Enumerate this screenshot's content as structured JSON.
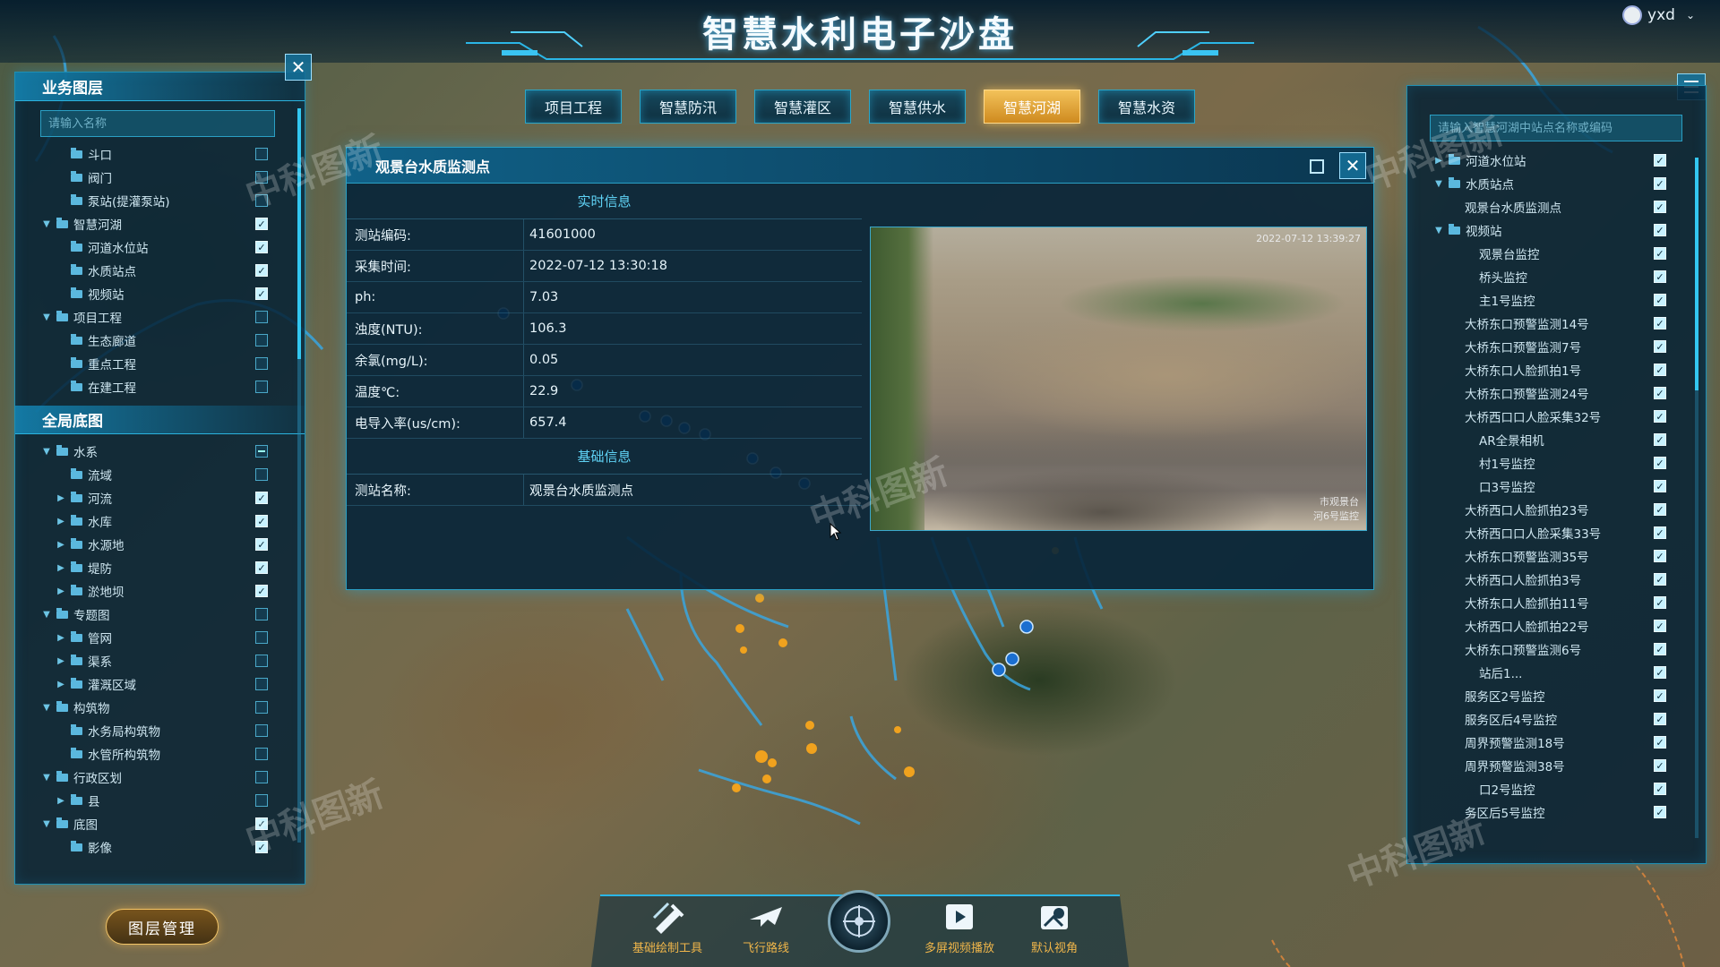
{
  "header": {
    "title": "智慧水利电子沙盘",
    "user": "yxd"
  },
  "tabs": [
    {
      "label": "项目工程",
      "active": false
    },
    {
      "label": "智慧防汛",
      "active": false
    },
    {
      "label": "智慧灌区",
      "active": false
    },
    {
      "label": "智慧供水",
      "active": false
    },
    {
      "label": "智慧河湖",
      "active": true
    },
    {
      "label": "智慧水资",
      "active": false
    }
  ],
  "left_panel": {
    "section1_title": "业务图层",
    "search_placeholder": "请输入名称",
    "layers1": [
      {
        "label": "斗口",
        "indent": 2,
        "arrow": "",
        "check": "off"
      },
      {
        "label": "阀门",
        "indent": 2,
        "arrow": "",
        "check": "off"
      },
      {
        "label": "泵站(提灌泵站)",
        "indent": 2,
        "arrow": "",
        "check": "off"
      },
      {
        "label": "智慧河湖",
        "indent": 1,
        "arrow": "▼",
        "check": "on"
      },
      {
        "label": "河道水位站",
        "indent": 2,
        "arrow": "",
        "check": "on"
      },
      {
        "label": "水质站点",
        "indent": 2,
        "arrow": "",
        "check": "on"
      },
      {
        "label": "视频站",
        "indent": 2,
        "arrow": "",
        "check": "on"
      },
      {
        "label": "项目工程",
        "indent": 1,
        "arrow": "▼",
        "check": "off"
      },
      {
        "label": "生态廊道",
        "indent": 2,
        "arrow": "",
        "check": "off"
      },
      {
        "label": "重点工程",
        "indent": 2,
        "arrow": "",
        "check": "off"
      },
      {
        "label": "在建工程",
        "indent": 2,
        "arrow": "",
        "check": "off"
      }
    ],
    "section2_title": "全局底图",
    "layers2": [
      {
        "label": "水系",
        "indent": 1,
        "arrow": "▼",
        "check": "partial"
      },
      {
        "label": "流域",
        "indent": 2,
        "arrow": "",
        "check": "off"
      },
      {
        "label": "河流",
        "indent": 2,
        "arrow": "▶",
        "check": "on"
      },
      {
        "label": "水库",
        "indent": 2,
        "arrow": "▶",
        "check": "on"
      },
      {
        "label": "水源地",
        "indent": 2,
        "arrow": "▶",
        "check": "on"
      },
      {
        "label": "堤防",
        "indent": 2,
        "arrow": "▶",
        "check": "on"
      },
      {
        "label": "淤地坝",
        "indent": 2,
        "arrow": "▶",
        "check": "on"
      },
      {
        "label": "专题图",
        "indent": 1,
        "arrow": "▼",
        "check": "off"
      },
      {
        "label": "管网",
        "indent": 2,
        "arrow": "▶",
        "check": "off"
      },
      {
        "label": "渠系",
        "indent": 2,
        "arrow": "▶",
        "check": "off"
      },
      {
        "label": "灌溉区域",
        "indent": 2,
        "arrow": "▶",
        "check": "off"
      },
      {
        "label": "构筑物",
        "indent": 1,
        "arrow": "▼",
        "check": "off"
      },
      {
        "label": "水务局构筑物",
        "indent": 2,
        "arrow": "",
        "check": "off"
      },
      {
        "label": "水管所构筑物",
        "indent": 2,
        "arrow": "",
        "check": "off"
      },
      {
        "label": "行政区划",
        "indent": 1,
        "arrow": "▼",
        "check": "off"
      },
      {
        "label": "县",
        "indent": 2,
        "arrow": "▶",
        "check": "off"
      },
      {
        "label": "底图",
        "indent": 1,
        "arrow": "▼",
        "check": "on"
      },
      {
        "label": "影像",
        "indent": 2,
        "arrow": "",
        "check": "on"
      }
    ],
    "layer_mgmt_button": "图层管理"
  },
  "right_panel": {
    "search_placeholder": "请输入智慧河湖中站点名称或编码",
    "items": [
      {
        "label": "河道水位站",
        "indent": 1,
        "arrow": "▶",
        "folder": true,
        "check": "on"
      },
      {
        "label": "水质站点",
        "indent": 1,
        "arrow": "▼",
        "folder": true,
        "check": "on"
      },
      {
        "label": "观景台水质监测点",
        "indent": 2,
        "arrow": "",
        "folder": false,
        "check": "on"
      },
      {
        "label": "视频站",
        "indent": 1,
        "arrow": "▼",
        "folder": true,
        "check": "on"
      },
      {
        "label": "观景台监控",
        "indent": 3,
        "arrow": "",
        "folder": false,
        "check": "on"
      },
      {
        "label": "桥头监控",
        "indent": 3,
        "arrow": "",
        "folder": false,
        "check": "on"
      },
      {
        "label": "主1号监控",
        "indent": 3,
        "arrow": "",
        "folder": false,
        "check": "on"
      },
      {
        "label": "大桥东口预警监测14号",
        "indent": 2,
        "arrow": "",
        "folder": false,
        "check": "on"
      },
      {
        "label": "大桥东口预警监测7号",
        "indent": 2,
        "arrow": "",
        "folder": false,
        "check": "on"
      },
      {
        "label": "大桥东口人脸抓拍1号",
        "indent": 2,
        "arrow": "",
        "folder": false,
        "check": "on"
      },
      {
        "label": "大桥东口预警监测24号",
        "indent": 2,
        "arrow": "",
        "folder": false,
        "check": "on"
      },
      {
        "label": "大桥西口口人脸采集32号",
        "indent": 2,
        "arrow": "",
        "folder": false,
        "check": "on"
      },
      {
        "label": "AR全景相机",
        "indent": 3,
        "arrow": "",
        "folder": false,
        "check": "on"
      },
      {
        "label": "村1号监控",
        "indent": 3,
        "arrow": "",
        "folder": false,
        "check": "on"
      },
      {
        "label": "口3号监控",
        "indent": 3,
        "arrow": "",
        "folder": false,
        "check": "on"
      },
      {
        "label": "大桥西口人脸抓拍23号",
        "indent": 2,
        "arrow": "",
        "folder": false,
        "check": "on"
      },
      {
        "label": "大桥西口口人脸采集33号",
        "indent": 2,
        "arrow": "",
        "folder": false,
        "check": "on"
      },
      {
        "label": "大桥东口预警监测35号",
        "indent": 2,
        "arrow": "",
        "folder": false,
        "check": "on"
      },
      {
        "label": "大桥西口人脸抓拍3号",
        "indent": 2,
        "arrow": "",
        "folder": false,
        "check": "on"
      },
      {
        "label": "大桥东口人脸抓拍11号",
        "indent": 2,
        "arrow": "",
        "folder": false,
        "check": "on"
      },
      {
        "label": "大桥西口人脸抓拍22号",
        "indent": 2,
        "arrow": "",
        "folder": false,
        "check": "on"
      },
      {
        "label": "大桥东口预警监测6号",
        "indent": 2,
        "arrow": "",
        "folder": false,
        "check": "on"
      },
      {
        "label": "站后1...",
        "indent": 3,
        "arrow": "",
        "folder": false,
        "check": "on"
      },
      {
        "label": "服务区2号监控",
        "indent": 2,
        "arrow": "",
        "folder": false,
        "check": "on"
      },
      {
        "label": "服务区后4号监控",
        "indent": 2,
        "arrow": "",
        "folder": false,
        "check": "on"
      },
      {
        "label": "周界预警监测18号",
        "indent": 2,
        "arrow": "",
        "folder": false,
        "check": "on"
      },
      {
        "label": "周界预警监测38号",
        "indent": 2,
        "arrow": "",
        "folder": false,
        "check": "on"
      },
      {
        "label": "口2号监控",
        "indent": 3,
        "arrow": "",
        "folder": false,
        "check": "on"
      },
      {
        "label": "务区后5号监控",
        "indent": 2,
        "arrow": "",
        "folder": false,
        "check": "on"
      }
    ]
  },
  "popup": {
    "title": "观景台水质监测点",
    "realtime_title": "实时信息",
    "rows": [
      {
        "k": "测站编码:",
        "v": "41601000"
      },
      {
        "k": "采集时间:",
        "v": "2022-07-12 13:30:18"
      },
      {
        "k": "ph:",
        "v": "7.03"
      },
      {
        "k": "浊度(NTU):",
        "v": "106.3"
      },
      {
        "k": "余氯(mg/L):",
        "v": "0.05"
      },
      {
        "k": "温度℃:",
        "v": "22.9"
      },
      {
        "k": "电导入率(us/cm):",
        "v": "657.4"
      }
    ],
    "basic_title": "基础信息",
    "basic_rows": [
      {
        "k": "测站名称:",
        "v": "观景台水质监测点"
      }
    ],
    "video_timestamp": "2022-07-12 13:39:27",
    "video_caption": "市观景台\n河6号监控"
  },
  "watermark": "中科图新",
  "toolbar": [
    {
      "label": "基础绘制工具",
      "icon": "pen-ruler-icon"
    },
    {
      "label": "飞行路线",
      "icon": "airplane-icon"
    },
    {
      "label": "多屏视频播放",
      "icon": "play-screen-icon"
    },
    {
      "label": "默认视角",
      "icon": "map-pin-icon"
    }
  ],
  "colors": {
    "accent": "#2aa6c8",
    "active_tab": "#e8a43a",
    "toolbar_text": "#f0b64a"
  }
}
